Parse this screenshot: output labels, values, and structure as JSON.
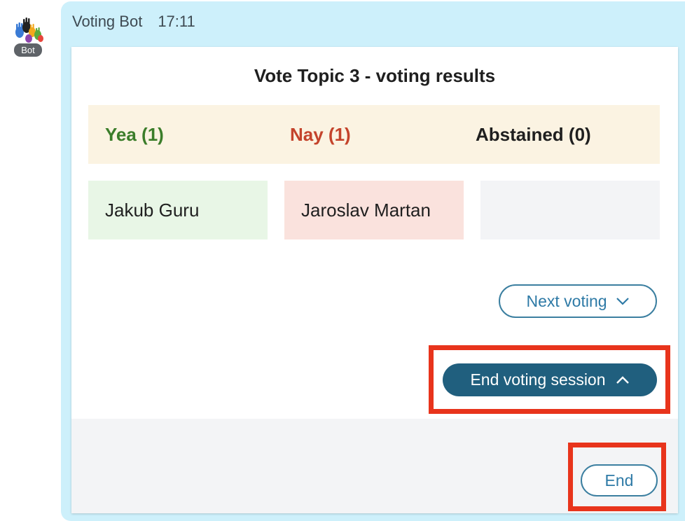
{
  "sender": {
    "name": "Voting Bot",
    "time": "17:11",
    "badge": "Bot"
  },
  "card": {
    "title": "Vote Topic 3 - voting results",
    "columns": [
      {
        "label": "Yea (1)",
        "color": "#3b7d2a",
        "voters": [
          "Jakub Guru"
        ]
      },
      {
        "label": "Nay (1)",
        "color": "#c4432b",
        "voters": [
          "Jaroslav Martan"
        ]
      },
      {
        "label": "Abstained (0)",
        "color": "#1f1f1f",
        "voters": []
      }
    ],
    "next_voting_label": "Next voting",
    "end_session_label": "End voting session",
    "end_label": "End"
  },
  "colors": {
    "bubble": "#cdf0fb",
    "primary_button": "#205f7e",
    "highlight": "#e8341c"
  },
  "icons": {
    "next_voting": "chevron-down-icon",
    "end_session": "chevron-up-icon",
    "avatar": "hands-logo"
  }
}
